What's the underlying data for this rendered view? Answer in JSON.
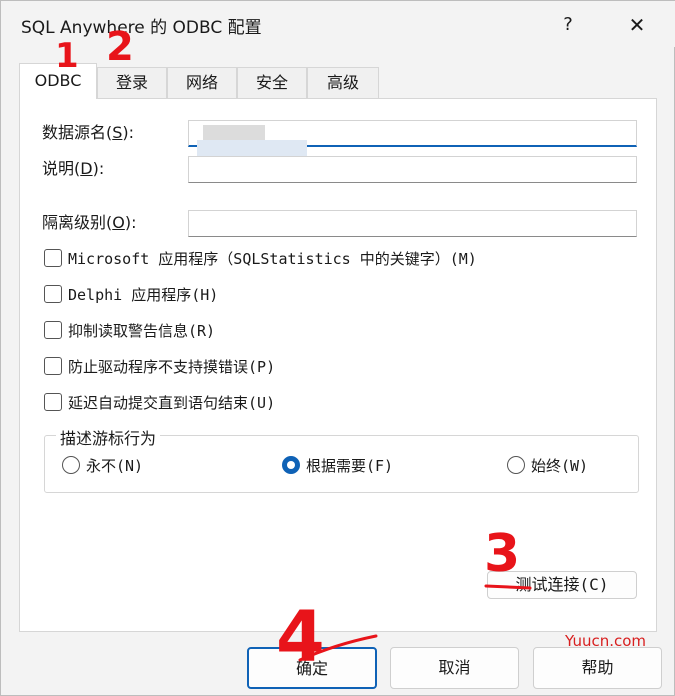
{
  "window": {
    "title": "SQL Anywhere 的 ODBC 配置",
    "help_glyph": "?",
    "close_glyph": "✕"
  },
  "tabs": [
    {
      "label": "ODBC"
    },
    {
      "label": "登录"
    },
    {
      "label": "网络"
    },
    {
      "label": "安全"
    },
    {
      "label": "高级"
    }
  ],
  "fields": {
    "data_source": {
      "label_pre": "数据源名(",
      "mnemonic": "S",
      "label_post": "):",
      "value": ""
    },
    "description": {
      "label_pre": "说明(",
      "mnemonic": "D",
      "label_post": "):",
      "value": ""
    },
    "isolation": {
      "label_pre": "隔离级别(",
      "mnemonic": "O",
      "label_post": "):",
      "value": ""
    }
  },
  "checkboxes": [
    {
      "label": "Microsoft 应用程序（SQLStatistics 中的关键字）(M)",
      "checked": false
    },
    {
      "label": "Delphi 应用程序(H)",
      "checked": false
    },
    {
      "label": "抑制读取警告信息(R)",
      "checked": false
    },
    {
      "label": "防止驱动程序不支持摸错误(P)",
      "checked": false
    },
    {
      "label": "延迟自动提交直到语句结束(U)",
      "checked": false
    }
  ],
  "cursor_group": {
    "title": "描述游标行为",
    "options": [
      {
        "label": "永不(N)",
        "selected": false
      },
      {
        "label": "根据需要(F)",
        "selected": true
      },
      {
        "label": "始终(W)",
        "selected": false
      }
    ]
  },
  "buttons": {
    "test": "测试连接(C)",
    "ok": "确定",
    "cancel": "取消",
    "help": "帮助"
  },
  "annotations": [
    "1",
    "2",
    "3",
    "4"
  ],
  "watermark": "Yuucn.com",
  "colors": {
    "accent": "#0f62b6",
    "annotation": "#e8141a"
  }
}
